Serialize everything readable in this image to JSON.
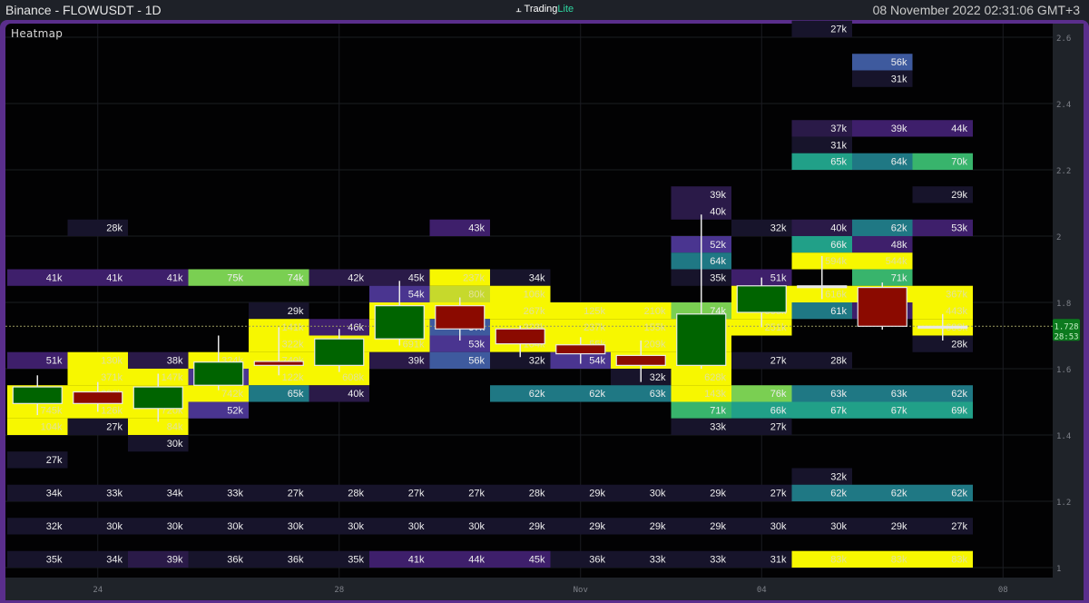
{
  "header": {
    "title": "Binance - FLOWUSDT - 1D",
    "logo_a": "Trading",
    "logo_b": "Lite",
    "datetime": "08 November 2022 02:31:06 GMT+3"
  },
  "panel": {
    "label": "Heatmap"
  },
  "price_axis": {
    "ticks": [
      "2.6",
      "2.4",
      "2.2",
      "2",
      "1.8",
      "1.6",
      "1.4",
      "1.2",
      "1"
    ],
    "tick_values": [
      2.6,
      2.4,
      2.2,
      2.0,
      1.8,
      1.6,
      1.4,
      1.2,
      1.0
    ],
    "current_price": "1.728",
    "current_value": 1.728,
    "countdown": "28:53"
  },
  "time_axis": {
    "labels": [
      {
        "text": "24",
        "col": 1
      },
      {
        "text": "28",
        "col": 5
      },
      {
        "text": "Nov",
        "col": 9
      },
      {
        "text": "04",
        "col": 12
      },
      {
        "text": "08",
        "col": 16
      }
    ]
  },
  "colors": {
    "d": "#17142b",
    "pd": "#2a1a48",
    "p": "#3e1f6b",
    "pm": "#4a3590",
    "b": "#3e5a9e",
    "t": "#1f7884",
    "tg": "#21a088",
    "g": "#38b46c",
    "l": "#7acf52",
    "ly": "#c6d92c",
    "y": "#f7f700",
    "up": "#006400",
    "down": "#8b0a00",
    "price_tag": "#0c7a1e"
  },
  "cells": [
    [
      13,
      2.625,
      "27k",
      "d"
    ],
    [
      14,
      2.525,
      "56k",
      "b"
    ],
    [
      14,
      2.475,
      "31k",
      "d"
    ],
    [
      13,
      2.325,
      "37k",
      "pd"
    ],
    [
      14,
      2.325,
      "39k",
      "p"
    ],
    [
      15,
      2.325,
      "44k",
      "p"
    ],
    [
      13,
      2.275,
      "31k",
      "d"
    ],
    [
      13,
      2.225,
      "65k",
      "tg"
    ],
    [
      14,
      2.225,
      "64k",
      "t"
    ],
    [
      15,
      2.225,
      "70k",
      "g"
    ],
    [
      11,
      2.125,
      "39k",
      "pd"
    ],
    [
      15,
      2.125,
      "29k",
      "d"
    ],
    [
      11,
      2.075,
      "40k",
      "pd"
    ],
    [
      1,
      2.025,
      "28k",
      "d"
    ],
    [
      7,
      2.025,
      "43k",
      "p"
    ],
    [
      12,
      2.025,
      "32k",
      "d"
    ],
    [
      13,
      2.025,
      "40k",
      "pd"
    ],
    [
      14,
      2.025,
      "62k",
      "t"
    ],
    [
      15,
      2.025,
      "53k",
      "p"
    ],
    [
      11,
      1.975,
      "52k",
      "pm"
    ],
    [
      13,
      1.975,
      "66k",
      "tg"
    ],
    [
      14,
      1.975,
      "48k",
      "p"
    ],
    [
      11,
      1.925,
      "64k",
      "t"
    ],
    [
      13,
      1.925,
      "594k",
      "y"
    ],
    [
      14,
      1.925,
      "544k",
      "y"
    ],
    [
      0,
      1.875,
      "41k",
      "p"
    ],
    [
      1,
      1.875,
      "41k",
      "p"
    ],
    [
      2,
      1.875,
      "41k",
      "p"
    ],
    [
      3,
      1.875,
      "75k",
      "l"
    ],
    [
      4,
      1.875,
      "74k",
      "l"
    ],
    [
      5,
      1.875,
      "42k",
      "pd"
    ],
    [
      6,
      1.875,
      "45k",
      "pd"
    ],
    [
      7,
      1.875,
      "237k",
      "y"
    ],
    [
      8,
      1.875,
      "34k",
      "d"
    ],
    [
      11,
      1.875,
      "35k",
      "d"
    ],
    [
      12,
      1.875,
      "51k",
      "p"
    ],
    [
      14,
      1.875,
      "71k",
      "g"
    ],
    [
      6,
      1.825,
      "54k",
      "pm"
    ],
    [
      7,
      1.825,
      "80k",
      "ly"
    ],
    [
      8,
      1.825,
      "106k",
      "y"
    ],
    [
      12,
      1.825,
      "339k",
      "y"
    ],
    [
      13,
      1.825,
      "616k",
      "y"
    ],
    [
      14,
      1.825,
      "187k",
      "y"
    ],
    [
      15,
      1.825,
      "367k",
      "y"
    ],
    [
      4,
      1.775,
      "29k",
      "d"
    ],
    [
      6,
      1.775,
      "187k",
      "y"
    ],
    [
      7,
      1.775,
      "116k",
      "y"
    ],
    [
      8,
      1.775,
      "267k",
      "y"
    ],
    [
      9,
      1.775,
      "125k",
      "y"
    ],
    [
      10,
      1.775,
      "210k",
      "y"
    ],
    [
      11,
      1.775,
      "74k",
      "l"
    ],
    [
      12,
      1.775,
      "555k",
      "y"
    ],
    [
      13,
      1.775,
      "61k",
      "t"
    ],
    [
      14,
      1.775,
      "45k",
      "p"
    ],
    [
      15,
      1.775,
      "443k",
      "y"
    ],
    [
      4,
      1.725,
      "141k",
      "y"
    ],
    [
      5,
      1.725,
      "46k",
      "p"
    ],
    [
      6,
      1.725,
      "310k",
      "y"
    ],
    [
      7,
      1.725,
      "57k",
      "b"
    ],
    [
      8,
      1.725,
      "328k",
      "y"
    ],
    [
      9,
      1.725,
      "237k",
      "y"
    ],
    [
      10,
      1.725,
      "155k",
      "y"
    ],
    [
      11,
      1.725,
      "240k",
      "y"
    ],
    [
      12,
      1.725,
      "251k",
      "y"
    ],
    [
      15,
      1.725,
      "688k",
      "y"
    ],
    [
      4,
      1.675,
      "322k",
      "y"
    ],
    [
      5,
      1.675,
      "250k",
      "y"
    ],
    [
      6,
      1.675,
      "691k",
      "y"
    ],
    [
      7,
      1.675,
      "53k",
      "pm"
    ],
    [
      8,
      1.675,
      "104k",
      "y"
    ],
    [
      9,
      1.675,
      "55k",
      "y"
    ],
    [
      10,
      1.675,
      "209k",
      "y"
    ],
    [
      11,
      1.675,
      "180k",
      "y"
    ],
    [
      15,
      1.675,
      "28k",
      "d"
    ],
    [
      0,
      1.625,
      "51k",
      "p"
    ],
    [
      1,
      1.625,
      "130k",
      "y"
    ],
    [
      2,
      1.625,
      "38k",
      "pd"
    ],
    [
      3,
      1.625,
      "324k",
      "y"
    ],
    [
      4,
      1.625,
      "740k",
      "y"
    ],
    [
      5,
      1.625,
      "270k",
      "y"
    ],
    [
      6,
      1.625,
      "39k",
      "pd"
    ],
    [
      7,
      1.625,
      "56k",
      "b"
    ],
    [
      8,
      1.625,
      "32k",
      "d"
    ],
    [
      9,
      1.625,
      "54k",
      "pm"
    ],
    [
      10,
      1.625,
      "160k",
      "y"
    ],
    [
      11,
      1.625,
      "210k",
      "y"
    ],
    [
      12,
      1.625,
      "27k",
      "d"
    ],
    [
      13,
      1.625,
      "28k",
      "d"
    ],
    [
      1,
      1.575,
      "371k",
      "y"
    ],
    [
      2,
      1.575,
      "147k",
      "y"
    ],
    [
      3,
      1.575,
      "50k",
      "pm"
    ],
    [
      4,
      1.575,
      "122k",
      "y"
    ],
    [
      5,
      1.575,
      "608k",
      "y"
    ],
    [
      10,
      1.575,
      "32k",
      "d"
    ],
    [
      11,
      1.575,
      "628k",
      "y"
    ],
    [
      0,
      1.525,
      "396k",
      "y"
    ],
    [
      1,
      1.525,
      "698k",
      "y"
    ],
    [
      2,
      1.525,
      "120k",
      "y"
    ],
    [
      3,
      1.525,
      "742k",
      "y"
    ],
    [
      4,
      1.525,
      "65k",
      "t"
    ],
    [
      5,
      1.525,
      "40k",
      "pd"
    ],
    [
      8,
      1.525,
      "62k",
      "t"
    ],
    [
      9,
      1.525,
      "62k",
      "t"
    ],
    [
      10,
      1.525,
      "63k",
      "t"
    ],
    [
      11,
      1.525,
      "143k",
      "y"
    ],
    [
      12,
      1.525,
      "76k",
      "l"
    ],
    [
      13,
      1.525,
      "63k",
      "t"
    ],
    [
      14,
      1.525,
      "63k",
      "t"
    ],
    [
      15,
      1.525,
      "62k",
      "t"
    ],
    [
      0,
      1.475,
      "745k",
      "y"
    ],
    [
      1,
      1.475,
      "126k",
      "y"
    ],
    [
      2,
      1.475,
      "720k",
      "y"
    ],
    [
      3,
      1.475,
      "52k",
      "pm"
    ],
    [
      11,
      1.475,
      "71k",
      "g"
    ],
    [
      12,
      1.475,
      "66k",
      "tg"
    ],
    [
      13,
      1.475,
      "67k",
      "tg"
    ],
    [
      14,
      1.475,
      "67k",
      "tg"
    ],
    [
      15,
      1.475,
      "69k",
      "tg"
    ],
    [
      0,
      1.425,
      "104k",
      "y"
    ],
    [
      1,
      1.425,
      "27k",
      "d"
    ],
    [
      2,
      1.425,
      "84k",
      "y"
    ],
    [
      11,
      1.425,
      "33k",
      "d"
    ],
    [
      12,
      1.425,
      "27k",
      "d"
    ],
    [
      2,
      1.375,
      "30k",
      "d"
    ],
    [
      0,
      1.325,
      "27k",
      "d"
    ],
    [
      13,
      1.275,
      "32k",
      "d"
    ],
    [
      0,
      1.225,
      "34k",
      "d"
    ],
    [
      1,
      1.225,
      "33k",
      "d"
    ],
    [
      2,
      1.225,
      "34k",
      "d"
    ],
    [
      3,
      1.225,
      "33k",
      "d"
    ],
    [
      4,
      1.225,
      "27k",
      "d"
    ],
    [
      5,
      1.225,
      "28k",
      "d"
    ],
    [
      6,
      1.225,
      "27k",
      "d"
    ],
    [
      7,
      1.225,
      "27k",
      "d"
    ],
    [
      8,
      1.225,
      "28k",
      "d"
    ],
    [
      9,
      1.225,
      "29k",
      "d"
    ],
    [
      10,
      1.225,
      "30k",
      "d"
    ],
    [
      11,
      1.225,
      "29k",
      "d"
    ],
    [
      12,
      1.225,
      "27k",
      "d"
    ],
    [
      13,
      1.225,
      "62k",
      "t"
    ],
    [
      14,
      1.225,
      "62k",
      "t"
    ],
    [
      15,
      1.225,
      "62k",
      "t"
    ],
    [
      0,
      1.125,
      "32k",
      "d"
    ],
    [
      1,
      1.125,
      "30k",
      "d"
    ],
    [
      2,
      1.125,
      "30k",
      "d"
    ],
    [
      3,
      1.125,
      "30k",
      "d"
    ],
    [
      4,
      1.125,
      "30k",
      "d"
    ],
    [
      5,
      1.125,
      "30k",
      "d"
    ],
    [
      6,
      1.125,
      "30k",
      "d"
    ],
    [
      7,
      1.125,
      "30k",
      "d"
    ],
    [
      8,
      1.125,
      "29k",
      "d"
    ],
    [
      9,
      1.125,
      "29k",
      "d"
    ],
    [
      10,
      1.125,
      "29k",
      "d"
    ],
    [
      11,
      1.125,
      "29k",
      "d"
    ],
    [
      12,
      1.125,
      "30k",
      "d"
    ],
    [
      13,
      1.125,
      "30k",
      "d"
    ],
    [
      14,
      1.125,
      "29k",
      "d"
    ],
    [
      15,
      1.125,
      "27k",
      "d"
    ],
    [
      0,
      1.025,
      "35k",
      "d"
    ],
    [
      1,
      1.025,
      "34k",
      "d"
    ],
    [
      2,
      1.025,
      "39k",
      "pd"
    ],
    [
      3,
      1.025,
      "36k",
      "d"
    ],
    [
      4,
      1.025,
      "36k",
      "d"
    ],
    [
      5,
      1.025,
      "35k",
      "d"
    ],
    [
      6,
      1.025,
      "41k",
      "p"
    ],
    [
      7,
      1.025,
      "44k",
      "p"
    ],
    [
      8,
      1.025,
      "45k",
      "p"
    ],
    [
      9,
      1.025,
      "36k",
      "d"
    ],
    [
      10,
      1.025,
      "33k",
      "d"
    ],
    [
      11,
      1.025,
      "33k",
      "d"
    ],
    [
      12,
      1.025,
      "31k",
      "d"
    ],
    [
      13,
      1.025,
      "83k",
      "y"
    ],
    [
      14,
      1.025,
      "83k",
      "y"
    ],
    [
      15,
      1.025,
      "83k",
      "y"
    ]
  ],
  "candles": [
    {
      "o": 1.495,
      "h": 1.58,
      "l": 1.46,
      "c": 1.545
    },
    {
      "o": 1.53,
      "h": 1.56,
      "l": 1.47,
      "c": 1.495
    },
    {
      "o": 1.48,
      "h": 1.585,
      "l": 1.44,
      "c": 1.545
    },
    {
      "o": 1.55,
      "h": 1.7,
      "l": 1.535,
      "c": 1.62
    },
    {
      "o": 1.622,
      "h": 1.725,
      "l": 1.58,
      "c": 1.61
    },
    {
      "o": 1.61,
      "h": 1.72,
      "l": 1.59,
      "c": 1.69
    },
    {
      "o": 1.69,
      "h": 1.865,
      "l": 1.67,
      "c": 1.79
    },
    {
      "o": 1.79,
      "h": 1.815,
      "l": 1.685,
      "c": 1.72
    },
    {
      "o": 1.72,
      "h": 1.73,
      "l": 1.635,
      "c": 1.675
    },
    {
      "o": 1.672,
      "h": 1.695,
      "l": 1.615,
      "c": 1.645
    },
    {
      "o": 1.64,
      "h": 1.685,
      "l": 1.56,
      "c": 1.61
    },
    {
      "o": 1.61,
      "h": 2.065,
      "l": 1.6,
      "c": 1.765
    },
    {
      "o": 1.77,
      "h": 1.875,
      "l": 1.725,
      "c": 1.85
    },
    {
      "o": 1.85,
      "h": 1.94,
      "l": 1.81,
      "c": 1.848
    },
    {
      "o": 1.845,
      "h": 1.86,
      "l": 1.718,
      "c": 1.728
    },
    {
      "o": 1.728,
      "h": 1.765,
      "l": 1.685,
      "c": 1.728
    }
  ]
}
